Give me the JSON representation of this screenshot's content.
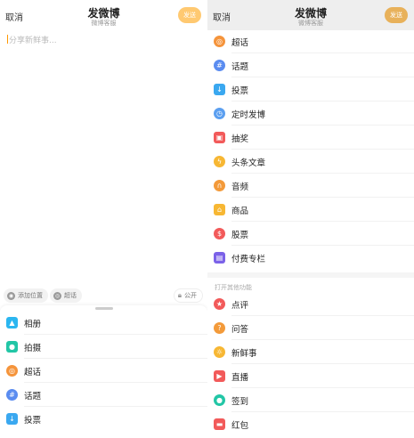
{
  "left": {
    "header": {
      "cancel": "取消",
      "title": "发微博",
      "subtitle": "微博客服",
      "send": "发送"
    },
    "compose_placeholder": "分享新鲜事...",
    "chips": {
      "location": "添加位置",
      "topic": "超话",
      "visibility": "公开"
    },
    "menu": [
      {
        "label": "相册",
        "icon": "photo-album-icon",
        "color": "#2bb6f0"
      },
      {
        "label": "拍摄",
        "icon": "camera-icon",
        "color": "#22c6a6"
      },
      {
        "label": "超话",
        "icon": "super-topic-icon",
        "color": "#f5943b"
      },
      {
        "label": "话题",
        "icon": "hashtag-icon",
        "color": "#5a8cf0"
      },
      {
        "label": "投票",
        "icon": "vote-icon",
        "color": "#3aa8f0"
      }
    ]
  },
  "right": {
    "header": {
      "cancel": "取消",
      "title": "发微博",
      "subtitle": "微博客服",
      "send": "发送"
    },
    "menu": [
      {
        "label": "超话",
        "icon": "super-topic-icon",
        "color": "#f5943b"
      },
      {
        "label": "话题",
        "icon": "hashtag-icon",
        "color": "#5a8cf0"
      },
      {
        "label": "投票",
        "icon": "vote-icon",
        "color": "#3aa8f0"
      },
      {
        "label": "定时发博",
        "icon": "clock-icon",
        "color": "#5b9ff0"
      },
      {
        "label": "抽奖",
        "icon": "gift-icon",
        "color": "#f25a5a"
      },
      {
        "label": "头条文章",
        "icon": "lightning-icon",
        "color": "#f7b733"
      },
      {
        "label": "音频",
        "icon": "headphones-icon",
        "color": "#f39a3a"
      },
      {
        "label": "商品",
        "icon": "shopping-bag-icon",
        "color": "#f7b733"
      },
      {
        "label": "股票",
        "icon": "dollar-icon",
        "color": "#f25a5a"
      },
      {
        "label": "付费专栏",
        "icon": "paid-column-icon",
        "color": "#7b62e8"
      }
    ],
    "other_section_label": "打开其他功能",
    "other": [
      {
        "label": "点评",
        "icon": "star-icon",
        "color": "#f25a5a"
      },
      {
        "label": "问答",
        "icon": "question-icon",
        "color": "#f39a3a"
      },
      {
        "label": "新鲜事",
        "icon": "sun-icon",
        "color": "#f7b733"
      },
      {
        "label": "直播",
        "icon": "video-icon",
        "color": "#f25a5a"
      },
      {
        "label": "签到",
        "icon": "location-pin-icon",
        "color": "#22c6a6"
      },
      {
        "label": "红包",
        "icon": "red-packet-icon",
        "color": "#f25a5a"
      }
    ]
  }
}
